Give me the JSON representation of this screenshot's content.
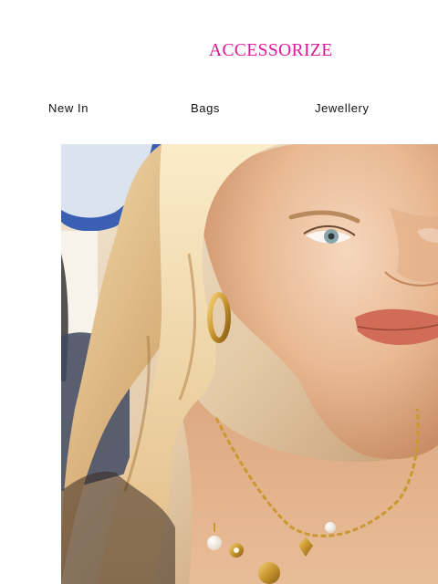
{
  "brand": {
    "logo_text": "ACCESSORIZE",
    "color": "#e0169a"
  },
  "nav": {
    "items": [
      {
        "label": "New In"
      },
      {
        "label": "Bags"
      },
      {
        "label": "Jewellery"
      }
    ]
  },
  "hero": {
    "subject": "photo of a blonde model wearing gold hoop earrings and a gold charm necklace with pearl drops"
  }
}
